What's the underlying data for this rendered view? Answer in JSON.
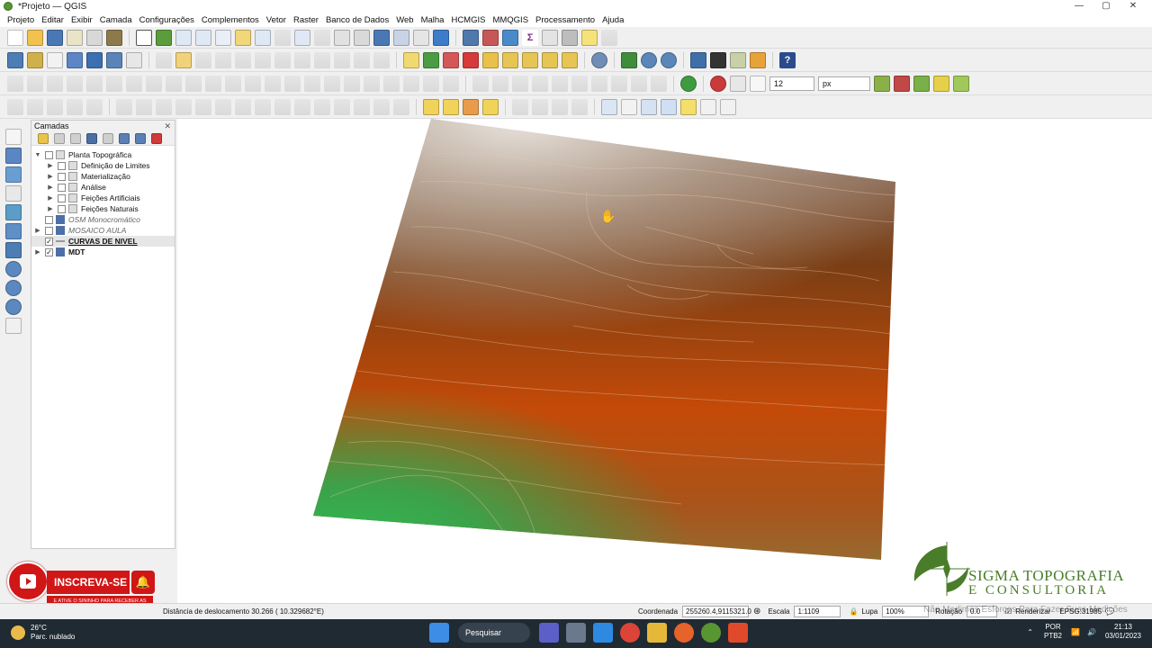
{
  "window": {
    "title": "*Projeto — QGIS",
    "controls": [
      "—",
      "▢",
      "✕"
    ]
  },
  "menu": [
    "Projeto",
    "Editar",
    "Exibir",
    "Camada",
    "Configurações",
    "Complementos",
    "Vetor",
    "Raster",
    "Banco de Dados",
    "Web",
    "Malha",
    "HCMGIS",
    "MMQGIS",
    "Processamento",
    "Ajuda"
  ],
  "toolbars": {
    "snapping_tolerance": "12",
    "snapping_units": "px"
  },
  "layers_panel": {
    "title": "Camadas",
    "close": "✕",
    "items": [
      {
        "label": "Planta Topográfica",
        "checked": false,
        "indent": 0,
        "expanded": true,
        "style": "group"
      },
      {
        "label": "Definição de Limites",
        "checked": false,
        "indent": 1,
        "style": "group"
      },
      {
        "label": "Materialização",
        "checked": false,
        "indent": 1,
        "style": "group"
      },
      {
        "label": "Análise",
        "checked": false,
        "indent": 1,
        "style": "group"
      },
      {
        "label": "Feições Artificiais",
        "checked": false,
        "indent": 1,
        "style": "group"
      },
      {
        "label": "Feições Naturais",
        "checked": false,
        "indent": 1,
        "style": "group"
      },
      {
        "label": "OSM Monocromático",
        "checked": false,
        "indent": 0,
        "style": "italic"
      },
      {
        "label": "MOSAICO AULA",
        "checked": false,
        "indent": 0,
        "style": "italic"
      },
      {
        "label": "CURVAS DE NIVEL",
        "checked": true,
        "indent": 0,
        "style": "bold-underline"
      },
      {
        "label": "MDT",
        "checked": true,
        "indent": 0,
        "style": "bold"
      }
    ]
  },
  "overlay": {
    "subscribe": "INSCREVA-SE",
    "subscribe_note": "E ATIVE O SININHO PARA RECEBER AS NOTIFICAÇÕES",
    "logo_line1": "SIGMA TOPOGRAFIA",
    "logo_line2": "E CONSULTORIA",
    "slogan": "Não Medimos Esforços Para Fazer Suas Medições"
  },
  "status": {
    "message": "Distância de deslocamento 30.266 ( 10.329682°E)",
    "coord_label": "Coordenada",
    "coord_value": "255260.4,9115321.0",
    "scale_label": "Escala",
    "scale_value": "1:1109",
    "magnifier_label": "Lupa",
    "magnifier_value": "100%",
    "rotation_label": "Rotação",
    "rotation_value": "0.0",
    "render_label": "Renderizar",
    "crs": "EPSG:31985"
  },
  "taskbar": {
    "temperature": "26°C",
    "weather": "Parc. nublado",
    "search": "Pesquisar",
    "lang1": "POR",
    "lang2": "PTB2",
    "time": "21:13",
    "date": "03/01/2023"
  },
  "colors": {
    "dem_high": "#a89a90",
    "dem_mid": "#7a3a0e",
    "dem_orange": "#c44a08",
    "dem_green": "#2fb84a",
    "brand_green": "#4a7d2a",
    "youtube_red": "#d01616"
  }
}
